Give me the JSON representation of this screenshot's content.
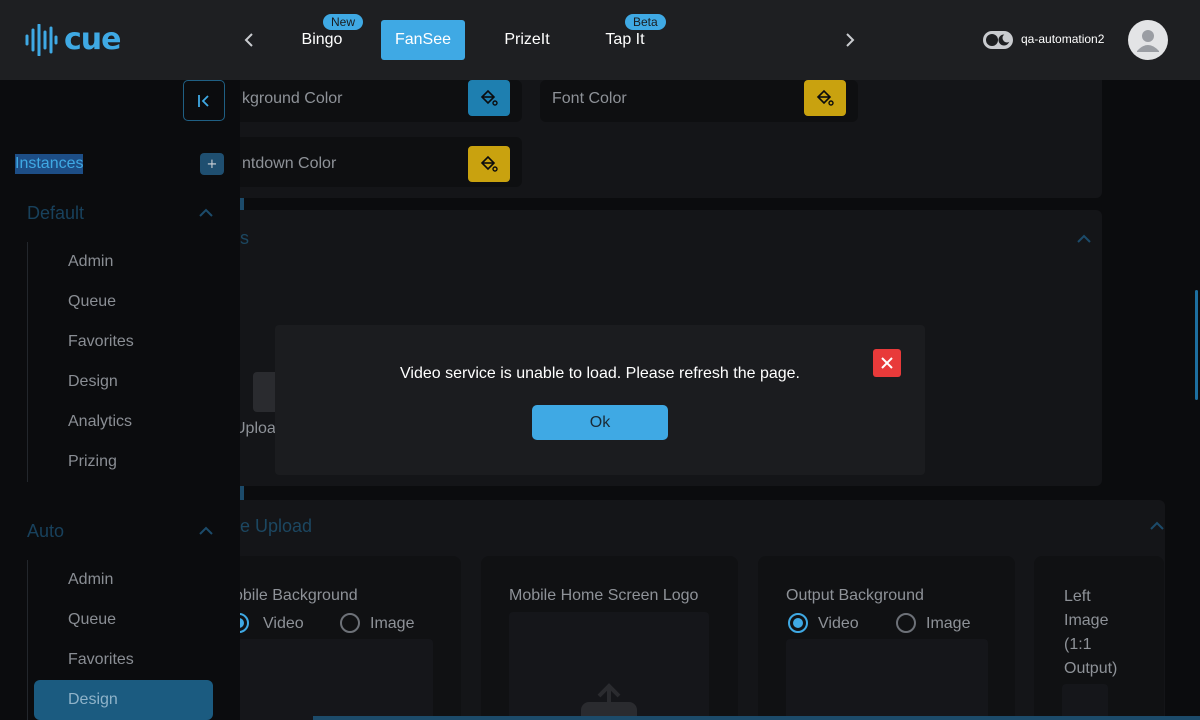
{
  "app": {
    "logo_text": "cue"
  },
  "topnav": {
    "tabs": [
      {
        "label": "Bingo",
        "badge": "New"
      },
      {
        "label": "FanSee",
        "badge": ""
      },
      {
        "label": "PrizeIt",
        "badge": ""
      },
      {
        "label": "Tap It",
        "badge": "Beta"
      }
    ],
    "username": "qa-automation2"
  },
  "sidebar": {
    "instances_label": "Instances",
    "add_label": "+",
    "groups": [
      {
        "title": "Default",
        "items": [
          "Admin",
          "Queue",
          "Favorites",
          "Design",
          "Analytics",
          "Prizing"
        ]
      },
      {
        "title": "Auto",
        "items": [
          "Admin",
          "Queue",
          "Favorites",
          "Design"
        ],
        "active_item": "Design"
      }
    ]
  },
  "main": {
    "colors": {
      "background_label": "kground Color",
      "font_label": "Font Color",
      "countdown_label": "ntdown Color"
    },
    "partial_section_title": "s",
    "partial_upload_text": "Uploa",
    "upload_section_title": "e Upload",
    "upload_cards": [
      {
        "title": "obile Background",
        "option_video": "Video",
        "option_image": "Image",
        "selected": "Video"
      },
      {
        "title": "Mobile Home Screen Logo"
      },
      {
        "title": "Output Background",
        "option_video": "Video",
        "option_image": "Image",
        "selected": "Video"
      },
      {
        "title_lines": [
          "Left",
          "Image",
          "(1:1",
          "Output)"
        ]
      }
    ]
  },
  "modal": {
    "message": "Video service is unable to load. Please refresh the page.",
    "ok_label": "Ok"
  },
  "colors": {
    "accent": "#3fa9e4",
    "swatch_blue": "#1e7fb0",
    "swatch_yellow": "#c9a20f",
    "close_red": "#e83a3a"
  }
}
